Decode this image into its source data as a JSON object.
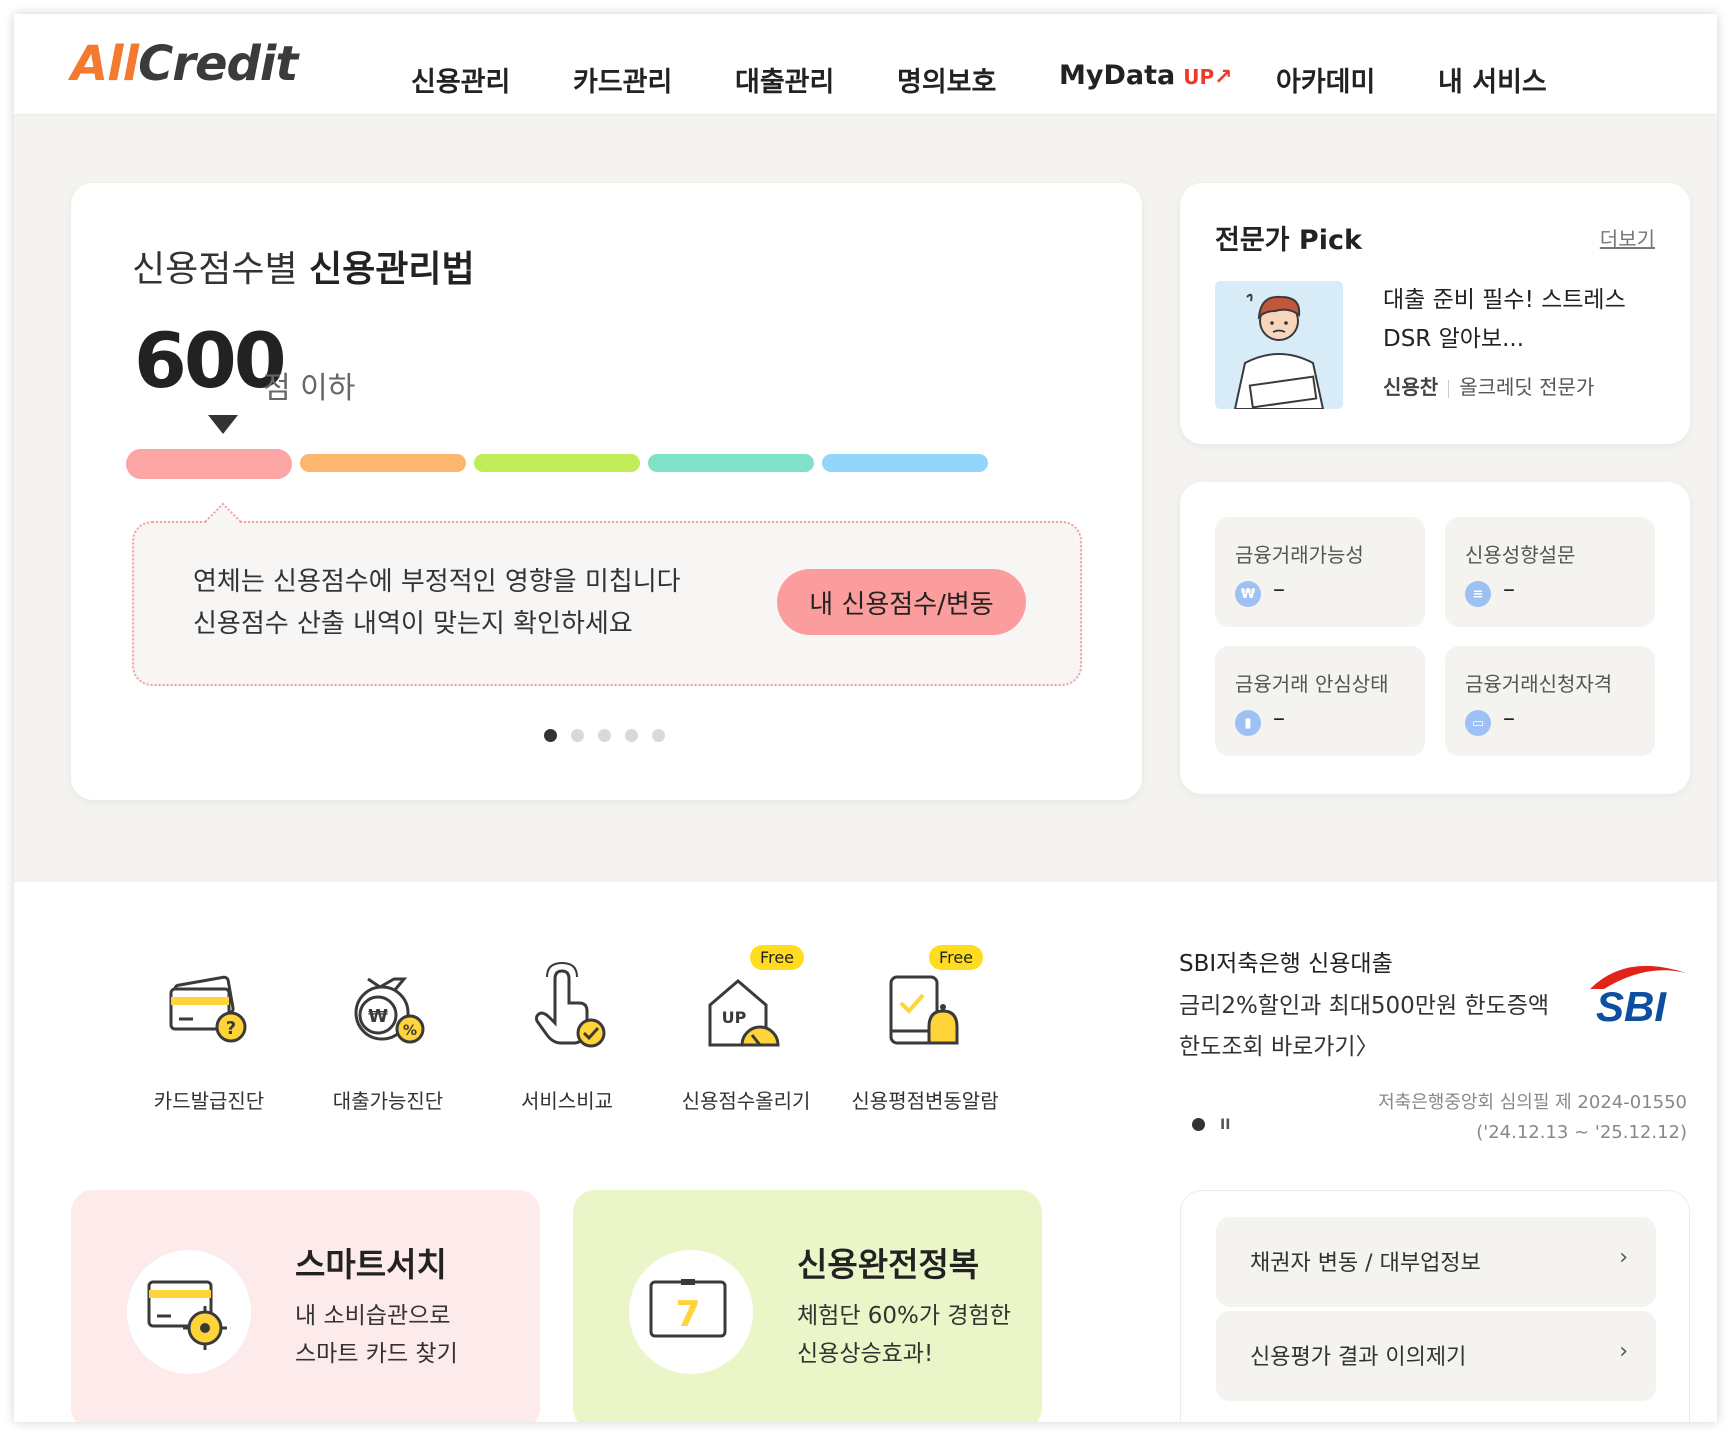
{
  "header": {
    "logo_a": "All",
    "logo_b": "Credit",
    "nav": [
      "신용관리",
      "카드관리",
      "대출관리",
      "명의보호",
      "MyData",
      "아카데미",
      "내 서비스"
    ],
    "mydata_badge": "UP"
  },
  "main_card": {
    "title_light": "신용점수별 ",
    "title_bold": "신용관리법",
    "score": "600",
    "score_unit": "점 이하",
    "bar_colors": [
      "#fca5a5",
      "#fdb66e",
      "#c1ec5a",
      "#7fe1c6",
      "#93d6fb"
    ],
    "active_bar_index": 0,
    "tip_line1": "연체는 신용점수에 부정적인 영향을 미칩니다",
    "tip_line2": "신용점수 산출 내역이 맞는지 확인하세요",
    "tip_button": "내 신용점수/변동",
    "slide_count": 5,
    "active_slide": 1
  },
  "pick": {
    "title": "전문가 Pick",
    "more": "더보기",
    "headline_line1": "대출 준비 필수! 스트레스",
    "headline_line2": "DSR 알아보...",
    "author": "신용찬",
    "role": "올크레딧 전문가"
  },
  "stats": [
    {
      "label": "금융거래가능성",
      "value": "–",
      "icon": "won-icon"
    },
    {
      "label": "신용성향설문",
      "value": "–",
      "icon": "document-icon"
    },
    {
      "label": "금융거래 안심상태",
      "value": "–",
      "icon": "bar-chart-icon"
    },
    {
      "label": "금융거래신청자격",
      "value": "–",
      "icon": "id-card-icon"
    }
  ],
  "services": [
    {
      "label": "카드발급진단",
      "free": ""
    },
    {
      "label": "대출가능진단",
      "free": ""
    },
    {
      "label": "서비스비교",
      "free": ""
    },
    {
      "label": "신용점수올리기",
      "free": "Free"
    },
    {
      "label": "신용평점변동알람",
      "free": "Free"
    }
  ],
  "ad": {
    "title": "SBI저축은행 신용대출",
    "subtitle": "금리2%할인과 최대500만원 한도증액",
    "link": "한도조회 바로가기〉",
    "brand": "SBI",
    "note1": "저축은행중앙회 심의필 제 2024-01550",
    "note2": "('24.12.13 ~ '25.12.12)",
    "pause": "II"
  },
  "promos": [
    {
      "title": "스마트서치",
      "line1": "내 소비습관으로",
      "line2": "스마트 카드 찾기",
      "bg": "#fdeaea"
    },
    {
      "title": "신용완전정복",
      "line1": "체험단 60%가 경험한",
      "line2": "신용상승효과!",
      "bg": "#eaf6c8"
    }
  ],
  "links": [
    {
      "label": "채권자 변동 / 대부업정보",
      "chev": "›"
    },
    {
      "label": "신용평가 결과 이의제기",
      "chev": "›"
    }
  ],
  "promo_calendar_day": "7"
}
